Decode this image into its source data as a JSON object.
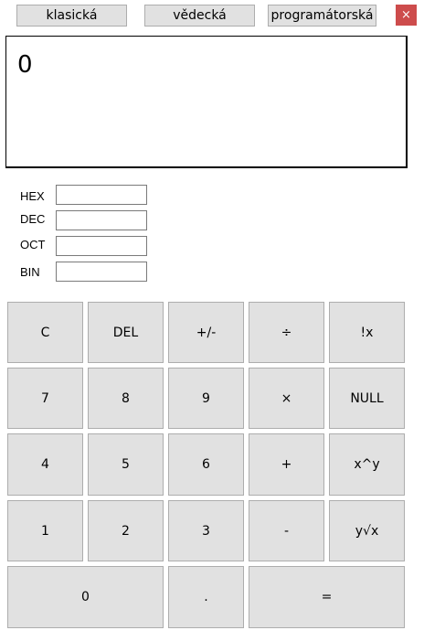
{
  "tabs": [
    {
      "label": "klasická"
    },
    {
      "label": "vědecká"
    },
    {
      "label": "programátorská"
    }
  ],
  "close_label": "×",
  "display": {
    "value": "0"
  },
  "bases": [
    {
      "label": "HEX",
      "value": ""
    },
    {
      "label": "DEC",
      "value": ""
    },
    {
      "label": "OCT",
      "value": ""
    },
    {
      "label": "BIN",
      "value": ""
    }
  ],
  "keys": {
    "clear": "C",
    "delete": "DEL",
    "negate": "+/-",
    "divide": "÷",
    "factorial": "!x",
    "seven": "7",
    "eight": "8",
    "nine": "9",
    "multiply": "×",
    "null": "NULL",
    "four": "4",
    "five": "5",
    "six": "6",
    "plus": "+",
    "power": "x^y",
    "one": "1",
    "two": "2",
    "three": "3",
    "minus": "-",
    "root": "y√x",
    "zero": "0",
    "decimal": ".",
    "equals": "="
  },
  "colors": {
    "close_bg": "#cd4c4c",
    "button_bg": "#e1e1e1",
    "button_border": "#adadad"
  }
}
